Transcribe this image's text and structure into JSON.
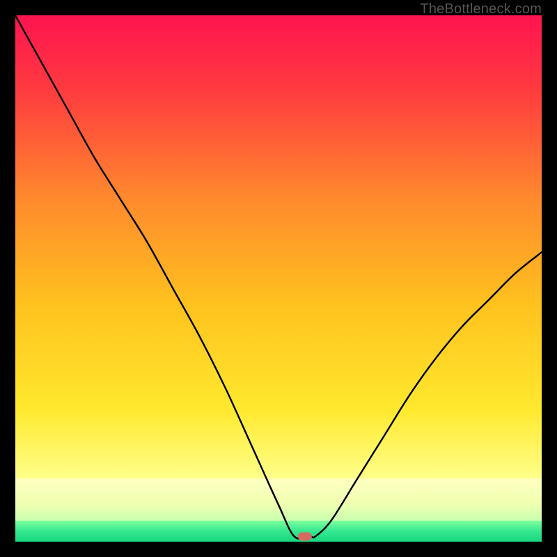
{
  "watermark": "TheBottleneck.com",
  "chart_data": {
    "type": "line",
    "title": "",
    "xlabel": "",
    "ylabel": "",
    "xlim": [
      0,
      100
    ],
    "ylim": [
      0,
      100
    ],
    "series": [
      {
        "name": "curve",
        "x": [
          0,
          5,
          10,
          15,
          20,
          25,
          30,
          35,
          40,
          45,
          50,
          53,
          56,
          57,
          60,
          65,
          70,
          75,
          80,
          85,
          90,
          95,
          100
        ],
        "y": [
          100,
          91,
          82,
          73,
          65,
          57,
          48,
          39,
          29,
          18,
          7,
          1,
          1,
          1,
          4,
          12,
          20,
          28,
          35,
          41,
          46,
          51,
          55
        ]
      }
    ],
    "marker": {
      "x": 55,
      "y": 1
    },
    "green_band": {
      "y0": 0,
      "y1": 4
    },
    "pale_band": {
      "y0": 4,
      "y1": 12
    },
    "gradient": {
      "top": "#ff1a4d",
      "mid": "#ffd400",
      "bottom": "#ffff9c"
    }
  }
}
